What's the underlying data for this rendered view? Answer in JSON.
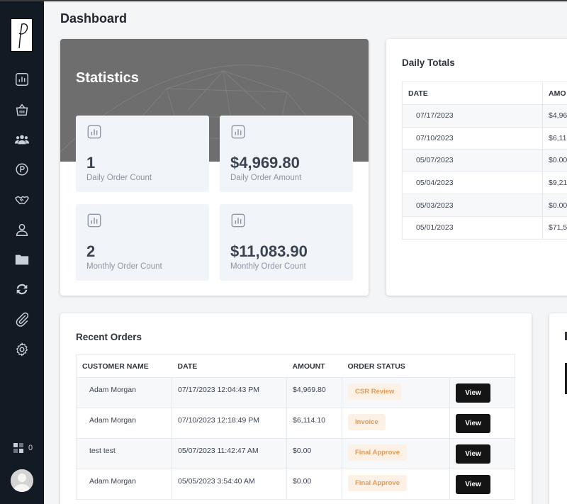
{
  "page": {
    "title": "Dashboard"
  },
  "sidebar": {
    "items": [
      {
        "icon": "chart-icon"
      },
      {
        "icon": "shopping-basket-icon"
      },
      {
        "icon": "users-icon"
      },
      {
        "icon": "p-circle-icon"
      },
      {
        "icon": "handshake-icon"
      },
      {
        "icon": "user-icon"
      },
      {
        "icon": "folder-icon"
      },
      {
        "icon": "sync-icon"
      },
      {
        "icon": "paperclip-icon"
      },
      {
        "icon": "gear-icon"
      }
    ],
    "widget_count": "0"
  },
  "statistics": {
    "title": "Statistics",
    "tiles": [
      {
        "value": "1",
        "label": "Daily Order Count"
      },
      {
        "value": "$4,969.80",
        "label": "Daily Order Amount"
      },
      {
        "value": "2",
        "label": "Monthly Order Count"
      },
      {
        "value": "$11,083.90",
        "label": "Monthly Order Count"
      }
    ]
  },
  "daily_totals": {
    "title": "Daily Totals",
    "columns": [
      "DATE",
      "AMO"
    ],
    "rows": [
      [
        "07/17/2023",
        "$4,96"
      ],
      [
        "07/10/2023",
        "$6,11"
      ],
      [
        "05/07/2023",
        "$0.00"
      ],
      [
        "05/04/2023",
        "$9,21"
      ],
      [
        "05/03/2023",
        "$0.00"
      ],
      [
        "05/01/2023",
        "$71,5"
      ]
    ]
  },
  "recent_orders": {
    "title": "Recent Orders",
    "columns": [
      "CUSTOMER NAME",
      "DATE",
      "AMOUNT",
      "ORDER STATUS",
      ""
    ],
    "rows": [
      {
        "customer": "Adam Morgan",
        "date": "07/17/2023 12:04:43 PM",
        "amount": "$4,969.80",
        "status": "CSR Review",
        "action": "View"
      },
      {
        "customer": "Adam Morgan",
        "date": "07/10/2023 12:18:49 PM",
        "amount": "$6,114.10",
        "status": "Invoice",
        "action": "View"
      },
      {
        "customer": "test test",
        "date": "05/07/2023 11:42:47 AM",
        "amount": "$0.00",
        "status": "Final Approve",
        "action": "View"
      },
      {
        "customer": "Adam Morgan",
        "date": "05/05/2023 3:54:40 AM",
        "amount": "$0.00",
        "status": "Final Approve",
        "action": "View"
      }
    ]
  },
  "colors": {
    "sidebar": "#121a24",
    "band": "#6e6e6e",
    "badge_bg": "#fdf0e4",
    "badge_text": "#e69a55",
    "button": "#141414"
  }
}
